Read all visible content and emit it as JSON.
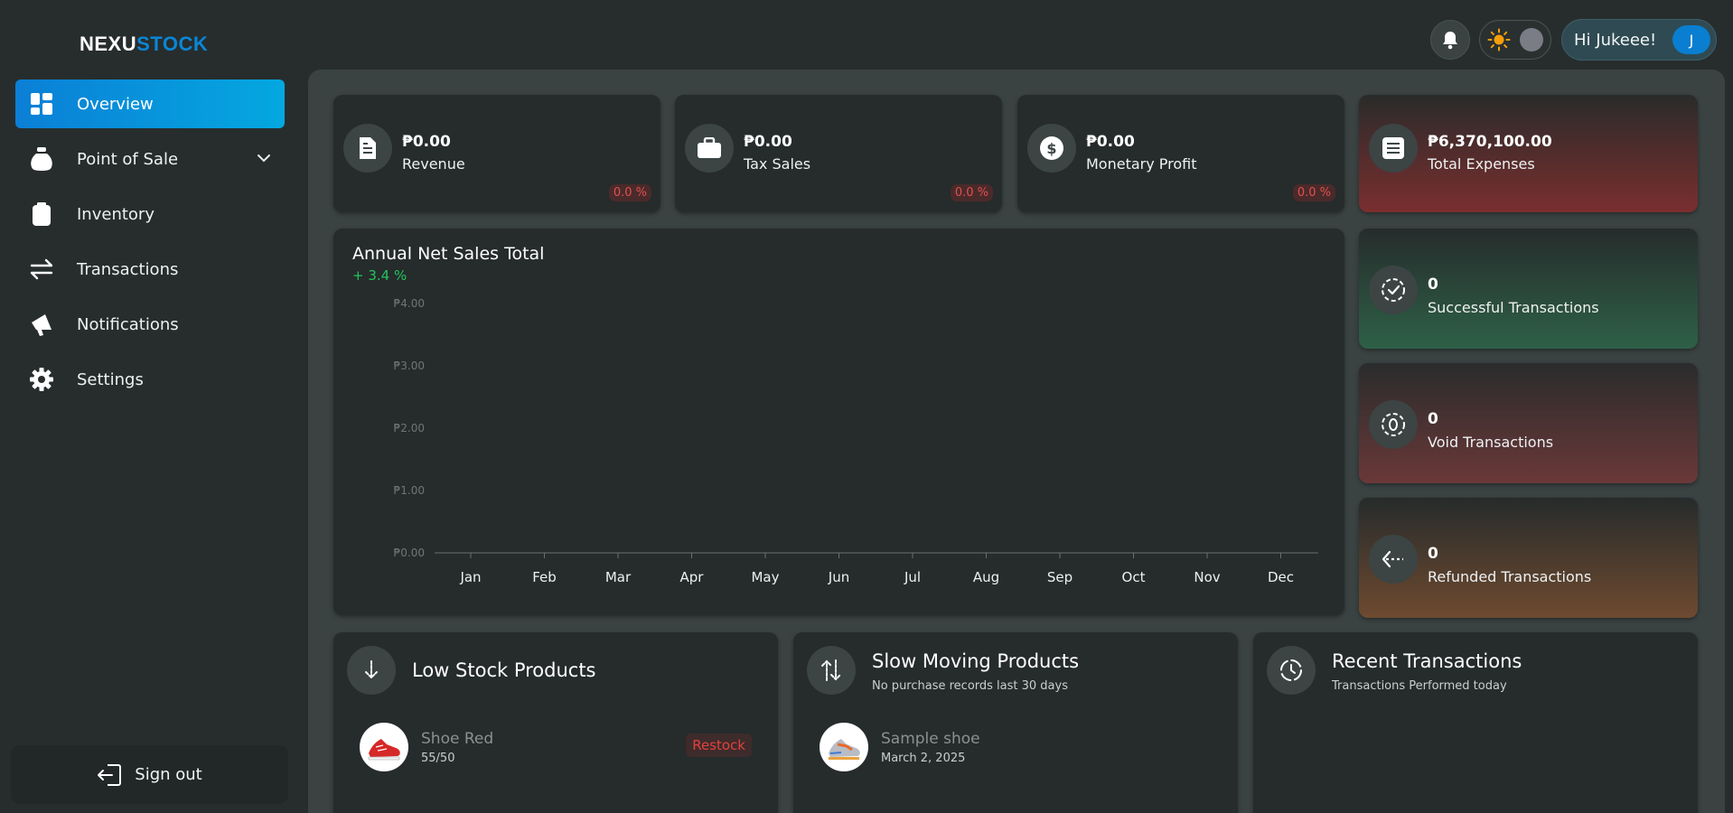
{
  "app": {
    "logo_part1": "NEXU",
    "logo_part2": "STOCK"
  },
  "sidebar": {
    "items": [
      {
        "label": "Overview",
        "icon": "dashboard-icon",
        "active": true
      },
      {
        "label": "Point of Sale",
        "icon": "money-bag-icon",
        "has_submenu": true
      },
      {
        "label": "Inventory",
        "icon": "clipboard-icon"
      },
      {
        "label": "Transactions",
        "icon": "swap-arrows-icon"
      },
      {
        "label": "Notifications",
        "icon": "megaphone-icon"
      },
      {
        "label": "Settings",
        "icon": "gear-icon"
      }
    ],
    "signout_label": "Sign out"
  },
  "topbar": {
    "greeting": "Hi Jukeee!",
    "avatar_initial": "J"
  },
  "stats": {
    "revenue": {
      "value": "₱0.00",
      "label": "Revenue",
      "change": "0.0 %"
    },
    "tax_sales": {
      "value": "₱0.00",
      "label": "Tax Sales",
      "change": "0.0 %"
    },
    "monetary_profit": {
      "value": "₱0.00",
      "label": "Monetary Profit",
      "change": "0.0 %"
    },
    "total_expenses": {
      "value": "₱6,370,100.00",
      "label": "Total Expenses"
    },
    "successful": {
      "value": "0",
      "label": "Successful Transactions"
    },
    "void": {
      "value": "0",
      "label": "Void Transactions"
    },
    "refunded": {
      "value": "0",
      "label": "Refunded Transactions"
    }
  },
  "chart": {
    "title": "Annual Net Sales Total",
    "growth": "+ 3.4 %"
  },
  "chart_data": {
    "type": "line",
    "title": "Annual Net Sales Total",
    "categories": [
      "Jan",
      "Feb",
      "Mar",
      "Apr",
      "May",
      "Jun",
      "Jul",
      "Aug",
      "Sep",
      "Oct",
      "Nov",
      "Dec"
    ],
    "y_ticks": [
      "₱0.00",
      "₱1.00",
      "₱2.00",
      "₱3.00",
      "₱4.00"
    ],
    "ylim": [
      0,
      4
    ],
    "series": [
      {
        "values": [
          0,
          0,
          0,
          0,
          0,
          0,
          0,
          0,
          0,
          0,
          0,
          0
        ]
      }
    ],
    "grid": false
  },
  "low_stock": {
    "title": "Low Stock Products",
    "items": [
      {
        "name": "Shoe Red",
        "stock": "55/50",
        "action": "Restock"
      }
    ]
  },
  "slow_moving": {
    "title": "Slow Moving Products",
    "subtitle": "No purchase records last 30 days",
    "items": [
      {
        "name": "Sample shoe",
        "date": "March 2, 2025"
      }
    ]
  },
  "recent": {
    "title": "Recent Transactions",
    "subtitle": "Transactions Performed today"
  },
  "colors": {
    "accent": "#0a86d6",
    "positive": "#22c55e",
    "negative": "#e05050"
  }
}
